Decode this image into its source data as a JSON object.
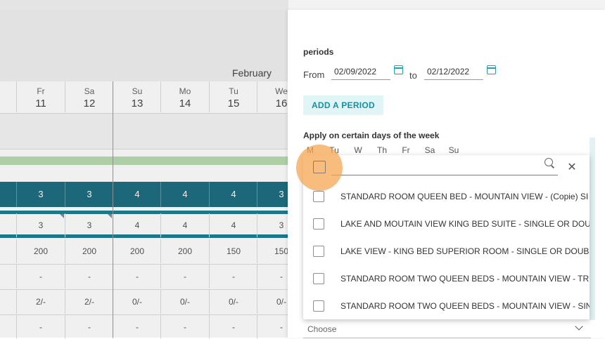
{
  "calendar": {
    "month": "February",
    "days": [
      {
        "name": "Fr",
        "num": "11"
      },
      {
        "name": "Sa",
        "num": "12"
      },
      {
        "name": "Su",
        "num": "13"
      },
      {
        "name": "Mo",
        "num": "14"
      },
      {
        "name": "Tu",
        "num": "15"
      },
      {
        "name": "We",
        "num": "16"
      }
    ],
    "row_teal": [
      "3",
      "3",
      "4",
      "4",
      "4",
      "3"
    ],
    "row_counts": [
      "3",
      "3",
      "4",
      "4",
      "4",
      "3"
    ],
    "row_prices": [
      "200",
      "200",
      "200",
      "200",
      "150",
      "150"
    ],
    "row_dash1": [
      "-",
      "-",
      "-",
      "-",
      "-",
      "-"
    ],
    "row_ratio": [
      "2/-",
      "2/-",
      "0/-",
      "0/-",
      "0/-",
      "0/-"
    ],
    "row_dash2": [
      "-",
      "-",
      "-",
      "-",
      "-",
      "-"
    ]
  },
  "panel": {
    "periods_title": "periods",
    "from_label": "From",
    "from_value": "02/09/2022",
    "to_label": "to",
    "to_value": "02/12/2022",
    "add_period_label": "ADD A PERIOD",
    "apply_title": "Apply on certain days of the week",
    "weekdays": [
      "M",
      "Tu",
      "W",
      "Th",
      "Fr",
      "Sa",
      "Su"
    ],
    "dropdown": {
      "search_placeholder": "",
      "items": [
        "STANDARD ROOM QUEEN BED - MOUNTAIN VIEW - (Copie) SI",
        "LAKE AND MOUTAIN VIEW KING BED SUITE - SINGLE OR DOU",
        "LAKE VIEW - KING BED SUPERIOR ROOM - SINGLE OR DOUBL",
        "STANDARD ROOM TWO QUEEN BEDS - MOUNTAIN VIEW - TR",
        "STANDARD ROOM TWO QUEEN BEDS - MOUNTAIN VIEW - SIN"
      ]
    },
    "choose_label": "Choose"
  },
  "colors": {
    "accent": "#1ba3b3",
    "teal_row": "#1e6f82",
    "highlight": "#f5a650"
  }
}
